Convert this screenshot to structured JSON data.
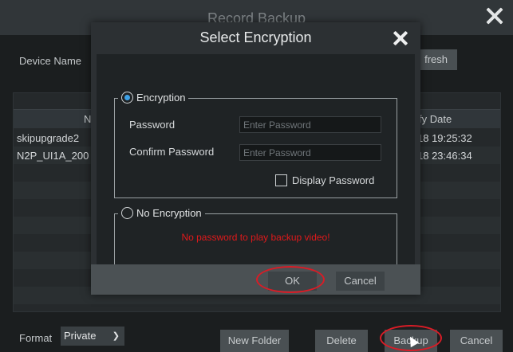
{
  "background": {
    "title": "Record Backup",
    "device_name_label": "Device Name",
    "refresh_button": "fresh",
    "table": {
      "col_name": "N",
      "col_date": "fy Date",
      "rows": [
        {
          "name": "skipupgrade2",
          "date": "18 19:25:32"
        },
        {
          "name": "N2P_UI1A_200",
          "date": "18 23:46:34"
        }
      ]
    },
    "footer": {
      "format_label": "Format",
      "format_value": "Private",
      "new_folder_button": "New Folder",
      "delete_button": "Delete",
      "backup_button": "Backup",
      "cancel_button": "Cancel"
    }
  },
  "modal": {
    "title": "Select Encryption",
    "encryption": {
      "label": "Encryption",
      "selected": true,
      "password_label": "Password",
      "password_placeholder": "Enter Password",
      "confirm_label": "Confirm Password",
      "confirm_placeholder": "Enter Password",
      "display_password_label": "Display Password"
    },
    "no_encryption": {
      "label": "No Encryption",
      "selected": false,
      "warning": "No password to play backup video!"
    },
    "ok_button": "OK",
    "cancel_button": "Cancel"
  },
  "colors": {
    "annotation_red": "#d81c26",
    "warning_red": "#e0191b",
    "radio_accent": "#3ea1e6"
  },
  "icons": [
    "close-icon",
    "chevron-down-icon",
    "mouse-cursor-icon"
  ]
}
